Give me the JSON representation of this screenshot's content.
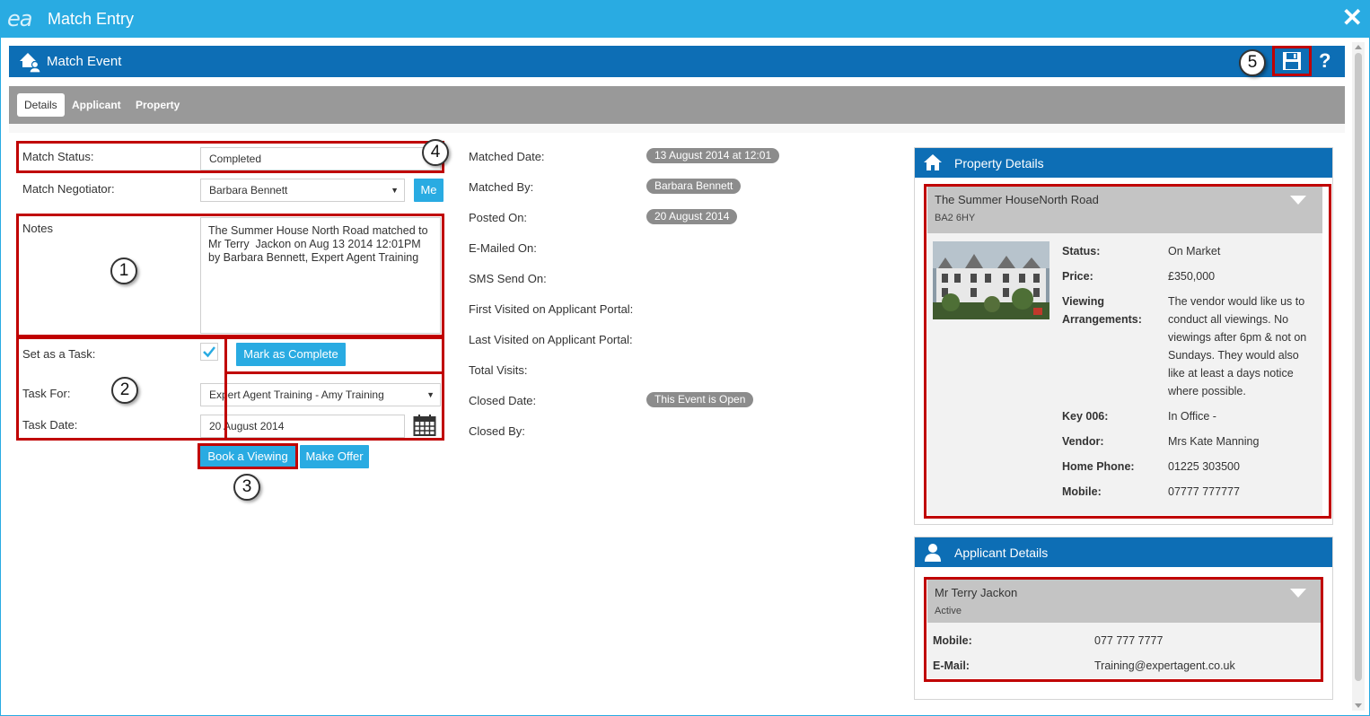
{
  "window": {
    "logo": "ea",
    "title": "Match Entry",
    "close_glyph": "✕"
  },
  "event_bar": {
    "title": "Match Event",
    "help_glyph": "?"
  },
  "tabs": [
    {
      "label": "Details",
      "active": true
    },
    {
      "label": "Applicant",
      "active": false
    },
    {
      "label": "Property",
      "active": false
    }
  ],
  "form": {
    "match_status_label": "Match Status:",
    "match_status_value": "Completed",
    "negotiator_label": "Match Negotiator:",
    "negotiator_value": "Barbara Bennett",
    "me_button": "Me",
    "notes_label": "Notes",
    "notes_value": "The Summer House North Road matched to Mr Terry  Jackon on Aug 13 2014 12:01PM by Barbara Bennett, Expert Agent Training",
    "task_label": "Set as a Task:",
    "task_checked": true,
    "mark_complete_button": "Mark as Complete",
    "task_for_label": "Task For:",
    "task_for_value": "Expert Agent Training - Amy Training",
    "task_date_label": "Task Date:",
    "task_date_value": "20 August 2014",
    "book_viewing_button": "Book a Viewing",
    "make_offer_button": "Make Offer"
  },
  "meta": {
    "matched_date_label": "Matched Date:",
    "matched_date_value": "13 August 2014 at 12:01",
    "matched_by_label": "Matched By:",
    "matched_by_value": "Barbara Bennett",
    "posted_on_label": "Posted On:",
    "posted_on_value": "20 August 2014",
    "emailed_on_label": "E-Mailed On:",
    "sms_label": "SMS Send On:",
    "first_visited_label": "First Visited on Applicant Portal:",
    "last_visited_label": "Last Visited on Applicant Portal:",
    "total_visits_label": "Total Visits:",
    "closed_date_label": "Closed Date:",
    "closed_date_value": "This Event is Open",
    "closed_by_label": "Closed By:"
  },
  "property_panel": {
    "title": "Property Details",
    "name": "The Summer HouseNorth Road",
    "postcode": "BA2 6HY",
    "status_label": "Status:",
    "status_value": "On Market",
    "price_label": "Price:",
    "price_value": "£350,000",
    "viewing_label_1": "Viewing",
    "viewing_label_2": "Arrangements:",
    "viewing_value": "The vendor would like us to conduct all viewings. No viewings after 6pm & not on Sundays. They would also like at least a days notice where possible.",
    "key_label": "Key 006:",
    "key_value": "In Office -",
    "vendor_label": "Vendor:",
    "vendor_value": "Mrs Kate Manning",
    "home_phone_label": "Home Phone:",
    "home_phone_value": "01225 303500",
    "mobile_label": "Mobile:",
    "mobile_value": "07777 777777"
  },
  "applicant_panel": {
    "title": "Applicant Details",
    "name": "Mr Terry Jackon",
    "status": "Active",
    "mobile_label": "Mobile:",
    "mobile_value": "077 777 7777",
    "email_label": "E-Mail:",
    "email_value": "Training@expertagent.co.uk"
  },
  "callouts": [
    "1",
    "2",
    "3",
    "4",
    "5"
  ],
  "colors": {
    "title_bar": "#29abe2",
    "header_bar": "#0d6eb5",
    "tab_bar": "#999999",
    "highlight": "#c00000",
    "button": "#29abe2"
  }
}
